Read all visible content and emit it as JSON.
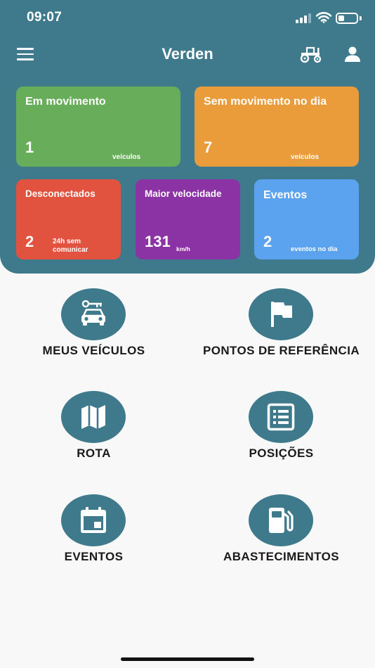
{
  "status_bar": {
    "time": "09:07"
  },
  "nav": {
    "title": "Verden",
    "icons": [
      "menu-icon",
      "tractor-icon",
      "user-icon"
    ]
  },
  "cards": [
    {
      "label": "Em movimento",
      "value": "1",
      "unit": "veículos",
      "color": "#68ad5a"
    },
    {
      "label": "Sem movimento no dia",
      "value": "7",
      "unit": "veículos",
      "color": "#ea9b3a"
    },
    {
      "label": "Desconectados",
      "value": "2",
      "unit_line1": "24h sem",
      "unit_line2": "comunicar",
      "color": "#e1533f"
    },
    {
      "label": "Maior velocidade",
      "value": "131",
      "unit": "km/h",
      "color": "#8b32a4"
    },
    {
      "label": "Eventos",
      "value": "2",
      "unit": "eventos no dia",
      "color": "#5ba3ee"
    }
  ],
  "menu": [
    {
      "label": "MEUS VEÍCULOS",
      "icon": "car-key-icon"
    },
    {
      "label": "PONTOS DE REFERÊNCIA",
      "icon": "flag-icon"
    },
    {
      "label": "ROTA",
      "icon": "map-icon"
    },
    {
      "label": "POSIÇÕES",
      "icon": "list-icon"
    },
    {
      "label": "EVENTOS",
      "icon": "calendar-icon"
    },
    {
      "label": "ABASTECIMENTOS",
      "icon": "fuel-pump-icon"
    }
  ],
  "colors": {
    "primary": "#3e7a8c",
    "background": "#f8f8f9"
  }
}
